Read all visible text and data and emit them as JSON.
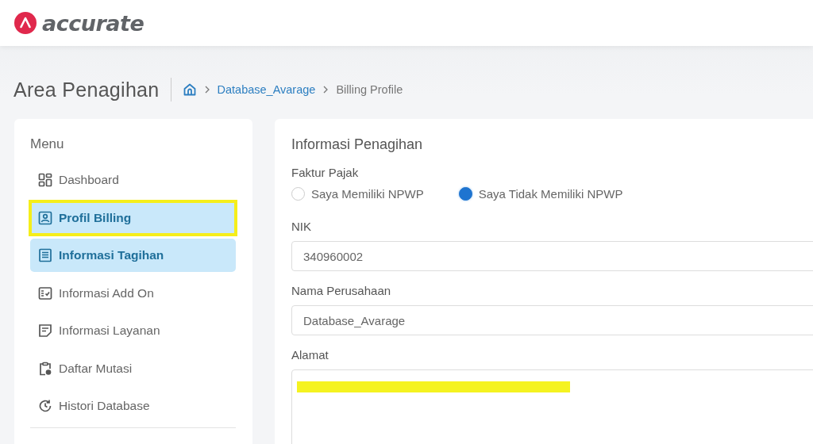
{
  "header": {
    "brand": "accurate"
  },
  "page": {
    "title": "Area Penagihan",
    "breadcrumbs": [
      {
        "label": "Database_Avarage",
        "kind": "link"
      },
      {
        "label": "Billing Profile",
        "kind": "current"
      }
    ]
  },
  "menu": {
    "title": "Menu",
    "items": [
      {
        "label": "Dashboard",
        "kind": "grid",
        "selected": false,
        "annotated": false
      },
      {
        "label": "Profil Billing",
        "kind": "profile",
        "selected": true,
        "annotated": true
      },
      {
        "label": "Informasi Tagihan",
        "kind": "receipt",
        "selected": true,
        "annotated": false
      },
      {
        "label": "Informasi Add On",
        "kind": "checklist",
        "selected": false,
        "annotated": false
      },
      {
        "label": "Informasi Layanan",
        "kind": "note",
        "selected": false,
        "annotated": false
      },
      {
        "label": "Daftar Mutasi",
        "kind": "clipboard",
        "selected": false,
        "annotated": false
      },
      {
        "label": "Histori Database",
        "kind": "history",
        "selected": false,
        "annotated": false
      }
    ]
  },
  "form": {
    "title": "Informasi Penagihan",
    "tax": {
      "label": "Faktur Pajak",
      "options": [
        {
          "label": "Saya Memiliki NPWP",
          "selected": false
        },
        {
          "label": "Saya Tidak Memiliki NPWP",
          "selected": true
        }
      ]
    },
    "fields": [
      {
        "label": "NIK",
        "value": "340960002",
        "kind": "input"
      },
      {
        "label": "Nama Perusahaan",
        "value": "Database_Avarage",
        "kind": "input"
      },
      {
        "label": "Alamat",
        "kind": "textarea",
        "redacted": true
      }
    ]
  }
}
